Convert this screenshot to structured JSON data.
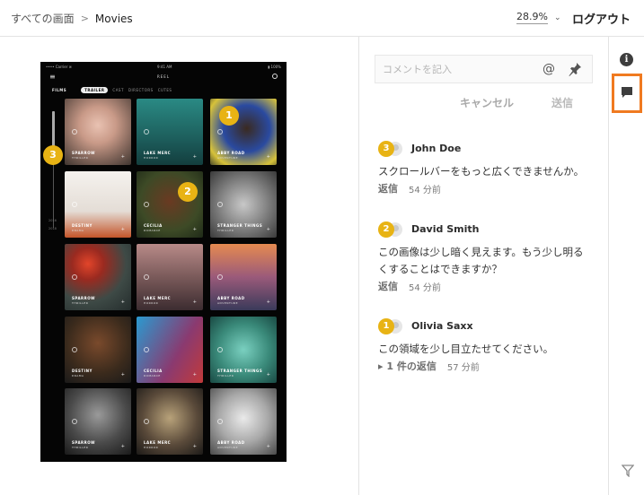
{
  "breadcrumb": {
    "root": "すべての画面",
    "current": "Movies"
  },
  "zoom": {
    "value": "28.9%"
  },
  "header": {
    "logout_label": "ログアウト"
  },
  "comment_form": {
    "placeholder": "コメントを記入",
    "at_symbol": "@",
    "cancel_label": "キャンセル",
    "send_label": "送信"
  },
  "comments": [
    {
      "pin": "3",
      "author": "John Doe",
      "text": "スクロールバーをもっと広くできませんか。",
      "action": "返信",
      "time": "54 分前"
    },
    {
      "pin": "2",
      "author": "David Smith",
      "text": "この画像は少し暗く見えます。もう少し明るくすることはできますか？",
      "action": "返信",
      "time": "54 分前"
    },
    {
      "pin": "1",
      "author": "Olivia Saxx",
      "text": "この領域を少し目立たせてください。",
      "action": "▸ 1 件の返信",
      "time": "57 分前"
    }
  ],
  "pins": [
    "1",
    "2",
    "3"
  ],
  "rail": {
    "info_icon": "i"
  },
  "mockup": {
    "status": {
      "left": "•••• Carrier ≋",
      "time": "9:41 AM",
      "right": "▮ 100%"
    },
    "menu_glyph": "≡",
    "app_name": "REEL",
    "tabs": [
      "FILMS",
      "TRAILER",
      "CAST",
      "DIRECTORS",
      "CUTES"
    ],
    "years": [
      "2016",
      "2018"
    ],
    "tiles": [
      {
        "title": "SPARROW",
        "sub": "THRILLER"
      },
      {
        "title": "LAKE MERC",
        "sub": "HORROR"
      },
      {
        "title": "ABBY ROAD",
        "sub": "ADVENTURE"
      },
      {
        "title": "DESTINY",
        "sub": "DRAMA"
      },
      {
        "title": "CECILIA",
        "sub": "ROMANCE"
      },
      {
        "title": "STRANGER THINGS",
        "sub": "THRILLER"
      },
      {
        "title": "SPARROW",
        "sub": "THRILLER"
      },
      {
        "title": "LAKE MERC",
        "sub": "HORROR"
      },
      {
        "title": "ABBY ROAD",
        "sub": "ADVENTURE"
      },
      {
        "title": "DESTINY",
        "sub": "DRAMA"
      },
      {
        "title": "CECILIA",
        "sub": "ROMANCE"
      },
      {
        "title": "STRANGER THINGS",
        "sub": "THRILLER"
      },
      {
        "title": "SPARROW",
        "sub": "THRILLER"
      },
      {
        "title": "LAKE MERC",
        "sub": "HORROR"
      },
      {
        "title": "ABBY ROAD",
        "sub": "ADVENTURE"
      }
    ]
  },
  "colors": {
    "accent": "#e8b314",
    "highlight": "#f07a20"
  }
}
